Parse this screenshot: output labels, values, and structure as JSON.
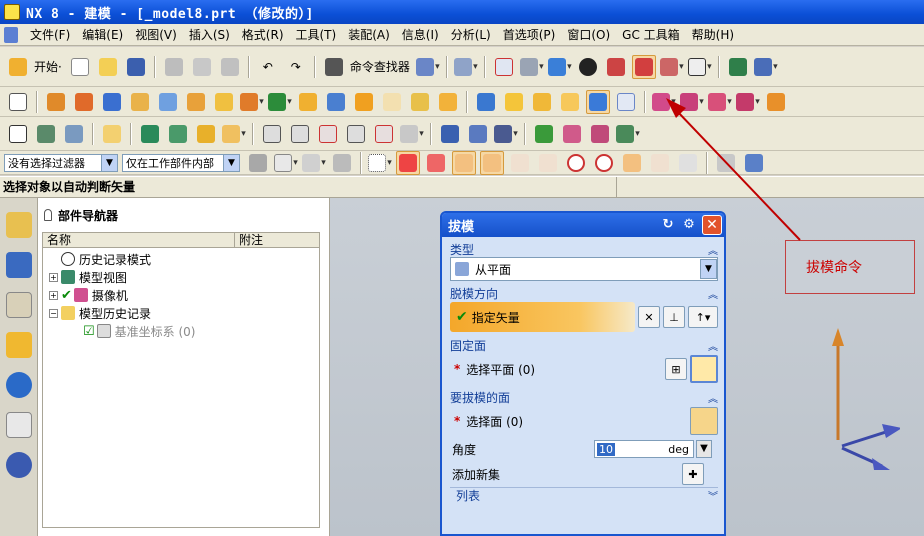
{
  "window": {
    "title": "NX 8 - 建模 - [_model8.prt  （修改的）]"
  },
  "menu": [
    {
      "label": "文件(F)"
    },
    {
      "label": "编辑(E)"
    },
    {
      "label": "视图(V)"
    },
    {
      "label": "插入(S)"
    },
    {
      "label": "格式(R)"
    },
    {
      "label": "工具(T)"
    },
    {
      "label": "装配(A)"
    },
    {
      "label": "信息(I)"
    },
    {
      "label": "分析(L)"
    },
    {
      "label": "首选项(P)"
    },
    {
      "label": "窗口(O)"
    },
    {
      "label": "GC 工具箱"
    },
    {
      "label": "帮助(H)"
    }
  ],
  "toolbar": {
    "start_label": "开始·",
    "command_finder_label": "命令查找器"
  },
  "selection_bar": {
    "filter_value": "没有选择过滤器",
    "scope_value": "仅在工作部件内部"
  },
  "status": {
    "hint": "选择对象以自动判断矢量"
  },
  "navigator": {
    "title": "部件导航器",
    "col_name": "名称",
    "col_note": "附注",
    "items": [
      {
        "label": "历史记录模式"
      },
      {
        "label": "模型视图"
      },
      {
        "label": "摄像机"
      },
      {
        "label": "模型历史记录"
      },
      {
        "label": "基准坐标系 (0)"
      }
    ]
  },
  "dialog": {
    "title": "拔模",
    "type_group": "类型",
    "type_value": "从平面",
    "direction_group": "脱模方向",
    "specify_vector": "指定矢量",
    "fixed_face_group": "固定面",
    "select_plane": "选择平面 (0)",
    "draft_faces_group": "要拔模的面",
    "select_face": "选择面 (0)",
    "angle_label": "角度",
    "angle_value": "10",
    "angle_unit": "deg",
    "add_new_set": "添加新集",
    "list_label": "列表"
  },
  "annotation": {
    "callout_text": "拔模命令"
  },
  "colors": {
    "titlebar": "#0b4fd6",
    "callout_red": "#c00000",
    "vector_orange": "#f4a72a"
  }
}
